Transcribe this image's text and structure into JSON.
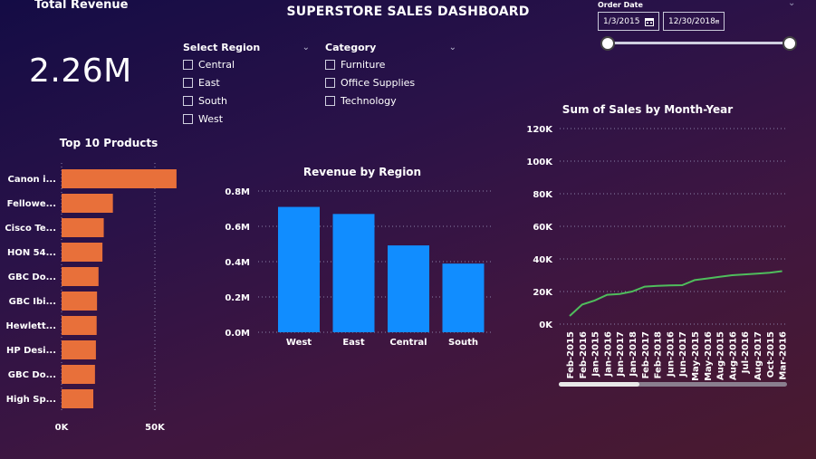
{
  "header": {
    "title": "SUPERSTORE SALES DASHBOARD"
  },
  "kpi": {
    "label": "Total Revenue",
    "value": "2.26M"
  },
  "region_slicer": {
    "title": "Select Region",
    "options": [
      "Central",
      "East",
      "South",
      "West"
    ]
  },
  "category_slicer": {
    "title": "Category",
    "options": [
      "Furniture",
      "Office Supplies",
      "Technology"
    ]
  },
  "date_filter": {
    "label": "Order Date",
    "start": "1/3/2015",
    "end": "12/30/2018"
  },
  "icons": {
    "calendar": "calendar-icon",
    "dropdown": "chevron-down-icon"
  },
  "colors": {
    "bar_products": "#e8703a",
    "bar_regions": "#118dff",
    "line": "#4fbd5c"
  },
  "chart_data": [
    {
      "type": "bar",
      "orientation": "horizontal",
      "title": "Top 10 Products",
      "categories": [
        "Canon i...",
        "Fellowe...",
        "Cisco Te...",
        "HON 54...",
        "GBC Do...",
        "GBC Ibi...",
        "Hewlett...",
        "HP Desi...",
        "GBC Do...",
        "High Sp..."
      ],
      "values": [
        61600,
        27500,
        22600,
        21900,
        19800,
        19000,
        18800,
        18400,
        17900,
        17000
      ],
      "xlim": [
        0,
        70000
      ],
      "x_ticks": [
        0,
        50000
      ],
      "x_tick_labels": [
        "0K",
        "50K"
      ]
    },
    {
      "type": "bar",
      "title": "Revenue by Region",
      "categories": [
        "West",
        "East",
        "Central",
        "South"
      ],
      "values": [
        710000,
        670000,
        492000,
        389000
      ],
      "ylim": [
        0,
        800000
      ],
      "y_ticks": [
        0,
        200000,
        400000,
        600000,
        800000
      ],
      "y_tick_labels": [
        "0.0M",
        "0.2M",
        "0.4M",
        "0.6M",
        "0.8M"
      ]
    },
    {
      "type": "line",
      "title": "Sum of Sales by Month-Year",
      "x": [
        "Feb-2015",
        "Feb-2016",
        "Jan-2015",
        "Jan-2016",
        "Jan-2017",
        "Jan-2018",
        "Feb-2017",
        "Feb-2018",
        "Jun-2016",
        "Jun-2017",
        "May-2015",
        "May-2016",
        "Aug-2015",
        "Aug-2016",
        "Jul-2016",
        "Aug-2017",
        "Oct-2015",
        "Mar-2016"
      ],
      "values": [
        5000,
        12000,
        14500,
        18000,
        18500,
        20000,
        23000,
        23500,
        23800,
        23900,
        27000,
        28000,
        29000,
        30000,
        30500,
        31000,
        31500,
        32500
      ],
      "ylim": [
        0,
        120000
      ],
      "y_ticks": [
        0,
        20000,
        40000,
        60000,
        80000,
        100000,
        120000
      ],
      "y_tick_labels": [
        "0K",
        "20K",
        "40K",
        "60K",
        "80K",
        "100K",
        "120K"
      ]
    }
  ]
}
